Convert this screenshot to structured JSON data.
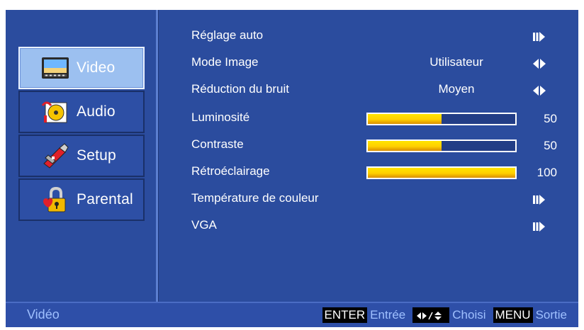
{
  "sidebar": {
    "tabs": [
      {
        "label": "Video",
        "icon": "video-icon",
        "active": true
      },
      {
        "label": "Audio",
        "icon": "audio-icon",
        "active": false
      },
      {
        "label": "Setup",
        "icon": "setup-icon",
        "active": false
      },
      {
        "label": "Parental",
        "icon": "parental-lock-icon",
        "active": false
      }
    ]
  },
  "menu": {
    "items": [
      {
        "label": "Réglage auto",
        "type": "submenu",
        "icon": "submenu-arrow-icon"
      },
      {
        "label": "Mode Image",
        "type": "select",
        "value": "Utilisateur",
        "icon": "left-right-arrow-icon"
      },
      {
        "label": "Réduction du bruit",
        "type": "select",
        "value": "Moyen",
        "icon": "left-right-arrow-icon"
      },
      {
        "label": "Luminosité",
        "type": "slider",
        "value": "50",
        "level": 0.5
      },
      {
        "label": "Contraste",
        "type": "slider",
        "value": "50",
        "level": 0.5
      },
      {
        "label": "Rétroéclairage",
        "type": "slider",
        "value": "100",
        "level": 1.0
      },
      {
        "label": "Température de couleur",
        "type": "submenu",
        "icon": "submenu-arrow-icon"
      },
      {
        "label": "VGA",
        "type": "submenu",
        "icon": "submenu-arrow-icon"
      }
    ]
  },
  "footer": {
    "title": "Vidéo",
    "enter_key": "ENTER",
    "enter_hint": "Entrée",
    "nav_key_icon": "navigation-arrows-icon",
    "choose_hint": "Choisi",
    "menu_key": "MENU",
    "exit_hint": "Sortie"
  },
  "colors": {
    "background": "#2b4c9e",
    "active_tab": "#9cc0f0",
    "bar_fill": "#ffd000",
    "hint_text": "#9fc0ff"
  }
}
